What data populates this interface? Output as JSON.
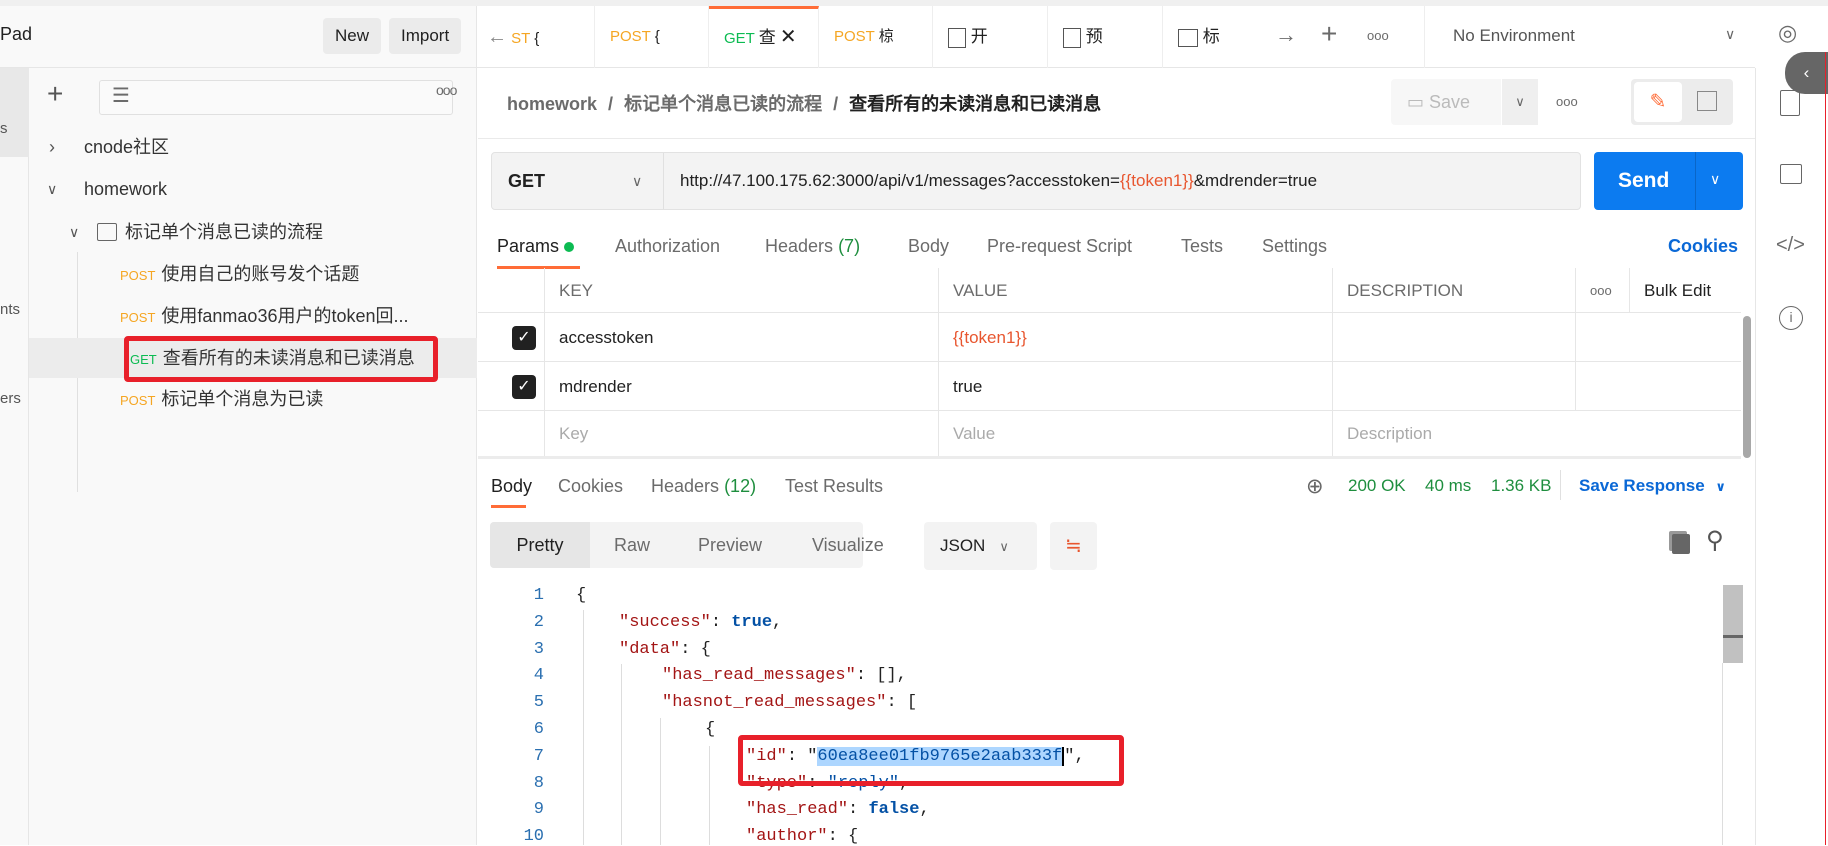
{
  "workspace": {
    "title": "Pad",
    "new_label": "New",
    "import_label": "Import"
  },
  "left_strip": [
    "s",
    "nts",
    "ers"
  ],
  "sidebar": {
    "items": [
      {
        "label": "cnode社区",
        "expanded": false
      },
      {
        "label": "homework",
        "expanded": true
      },
      {
        "label": "标记单个消息已读的流程",
        "type": "folder"
      },
      {
        "method": "POST",
        "label": "使用自己的账号发个话题"
      },
      {
        "method": "POST",
        "label": "使用fanmao36用户的token回..."
      },
      {
        "method": "GET",
        "label": "查看所有的未读消息和已读消息",
        "selected": true
      },
      {
        "method": "POST",
        "label": "标记单个消息为已读"
      }
    ]
  },
  "tabs": [
    {
      "method": "ST",
      "label": "{"
    },
    {
      "method": "POST",
      "label": "{"
    },
    {
      "method": "GET",
      "label": "查",
      "active": true
    },
    {
      "method": "POST",
      "label": "椋"
    },
    {
      "icon": "example-icon",
      "label": "开"
    },
    {
      "icon": "example-icon",
      "label": "预"
    },
    {
      "icon": "folder-icon",
      "label": "标"
    }
  ],
  "environment": "No Environment",
  "breadcrumb": [
    "homework",
    "/",
    "标记单个消息已读的流程",
    "/",
    "查看所有的未读消息和已读消息"
  ],
  "save_label": "Save",
  "request": {
    "method": "GET",
    "url_prefix": "http://47.100.175.62:3000/api/v1/messages?accesstoken=",
    "url_var": "{{token1}}",
    "url_suffix": "&mdrender=true",
    "send_label": "Send"
  },
  "req_tabs": [
    {
      "label": "Params"
    },
    {
      "label": "Authorization"
    },
    {
      "label": "Headers",
      "count": "(7)"
    },
    {
      "label": "Body"
    },
    {
      "label": "Pre-request Script"
    },
    {
      "label": "Tests"
    },
    {
      "label": "Settings"
    }
  ],
  "cookies_label": "Cookies",
  "params": {
    "headers": [
      "KEY",
      "VALUE",
      "DESCRIPTION",
      "Bulk Edit"
    ],
    "rows": [
      {
        "checked": true,
        "key": "accesstoken",
        "value": "{{token1}}",
        "description": ""
      },
      {
        "checked": true,
        "key": "mdrender",
        "value": "true",
        "description": ""
      }
    ],
    "placeholder": {
      "key": "Key",
      "value": "Value",
      "description": "Description"
    }
  },
  "resp_tabs": [
    {
      "label": "Body"
    },
    {
      "label": "Cookies"
    },
    {
      "label": "Headers",
      "count": "(12)"
    },
    {
      "label": "Test Results"
    }
  ],
  "status": {
    "code": "200 OK",
    "time": "40 ms",
    "size": "1.36 KB",
    "save_response": "Save Response"
  },
  "view_modes": [
    "Pretty",
    "Raw",
    "Preview",
    "Visualize"
  ],
  "format": "JSON",
  "colors": {
    "accent": "#ff6c37",
    "send": "#0c7bf0",
    "link": "#0a68d6",
    "status": "#1e8e3e",
    "highlight_box": "#e8202a"
  }
}
